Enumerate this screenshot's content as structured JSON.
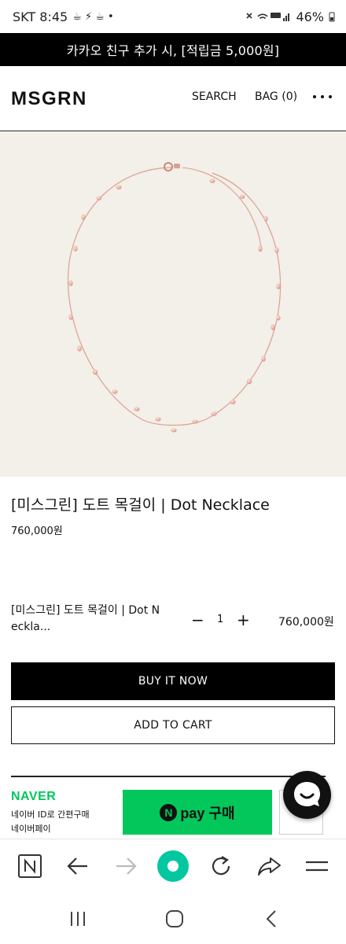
{
  "status_bar": {
    "carrier_time": "SKT 8:45",
    "battery": "46%"
  },
  "promo_banner": {
    "text": "카카오 친구 추가 시, [적립금 5,000원]"
  },
  "header": {
    "logo": "MSGRN",
    "search_label": "SEARCH",
    "bag_label": "BAG (0)"
  },
  "product": {
    "title": "[미스그린] 도트 목걸이 | Dot Necklace",
    "price": "760,000원",
    "image_icon": "necklace-image"
  },
  "selected_option": {
    "name": "[미스그린] 도트 목걸이 | Dot Necklace",
    "name_display": "[미스그린] 도트 목걸이 | Dot N eckla...",
    "quantity": "1",
    "minus_label": "−",
    "plus_label": "+",
    "price": "760,000원"
  },
  "actions": {
    "buy_now_label": "BUY IT NOW",
    "add_to_cart_label": "ADD TO CART"
  },
  "naver": {
    "logo": "NAVER",
    "line1": "네이버 ID로 간편구매",
    "line2": "네이버페이",
    "pay_n": "N",
    "pay_label": "pay 구매",
    "brand_color": "#03c75a"
  },
  "browser_toolbar": {
    "icons": [
      "naver-home-icon",
      "back-arrow-icon",
      "forward-arrow-icon",
      "home-circle-icon",
      "reload-icon",
      "share-icon",
      "menu-icon"
    ]
  },
  "system_nav": {
    "icons": [
      "recents-icon",
      "home-icon",
      "back-icon"
    ]
  }
}
